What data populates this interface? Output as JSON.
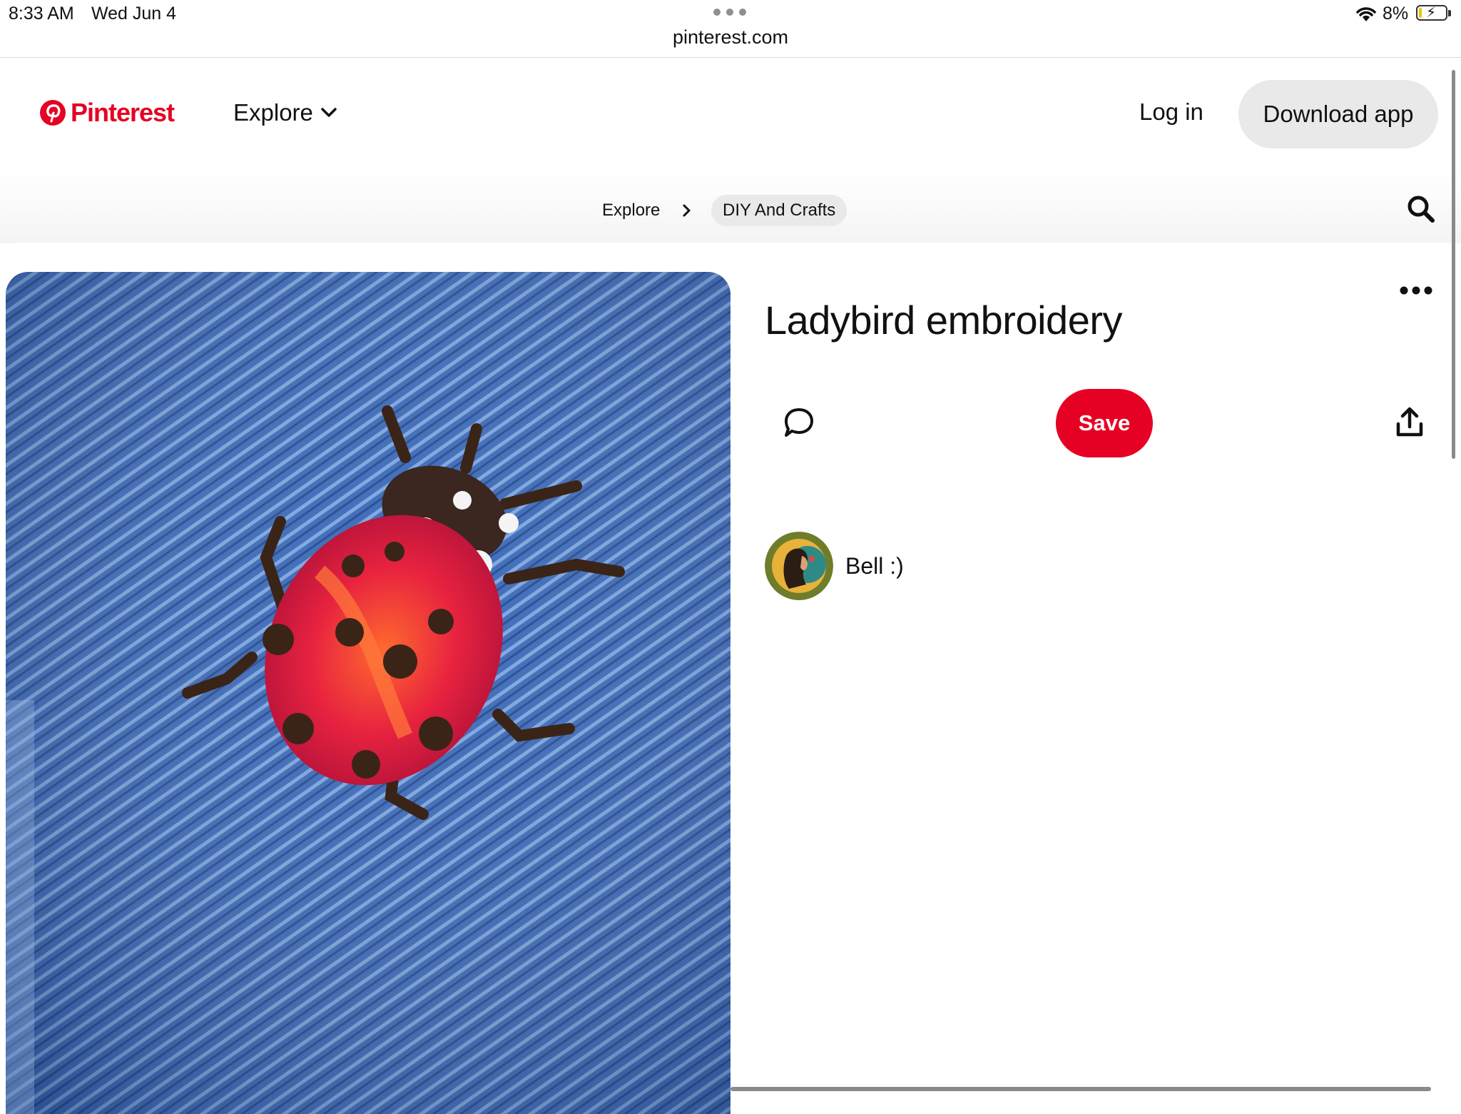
{
  "status_bar": {
    "time": "8:33 AM",
    "date": "Wed Jun 4",
    "url": "pinterest.com",
    "battery_percent": "8%",
    "battery_level": 0.08,
    "icons": [
      "wifi-icon",
      "battery-icon",
      "more-dots-icon"
    ]
  },
  "header": {
    "logo_text": "Pinterest",
    "explore_label": "Explore",
    "login_label": "Log in",
    "download_label": "Download app"
  },
  "breadcrumb": {
    "items": [
      "Explore",
      "DIY And Crafts"
    ]
  },
  "pin": {
    "title": "Ladybird embroidery",
    "save_label": "Save",
    "creator_name": "Bell :)",
    "image_description_icon": "ladybird-embroidery-on-denim"
  },
  "colors": {
    "brand_red": "#e60023",
    "chip_gray": "#e9e9e9",
    "denim_blue": "#3a6aba"
  }
}
